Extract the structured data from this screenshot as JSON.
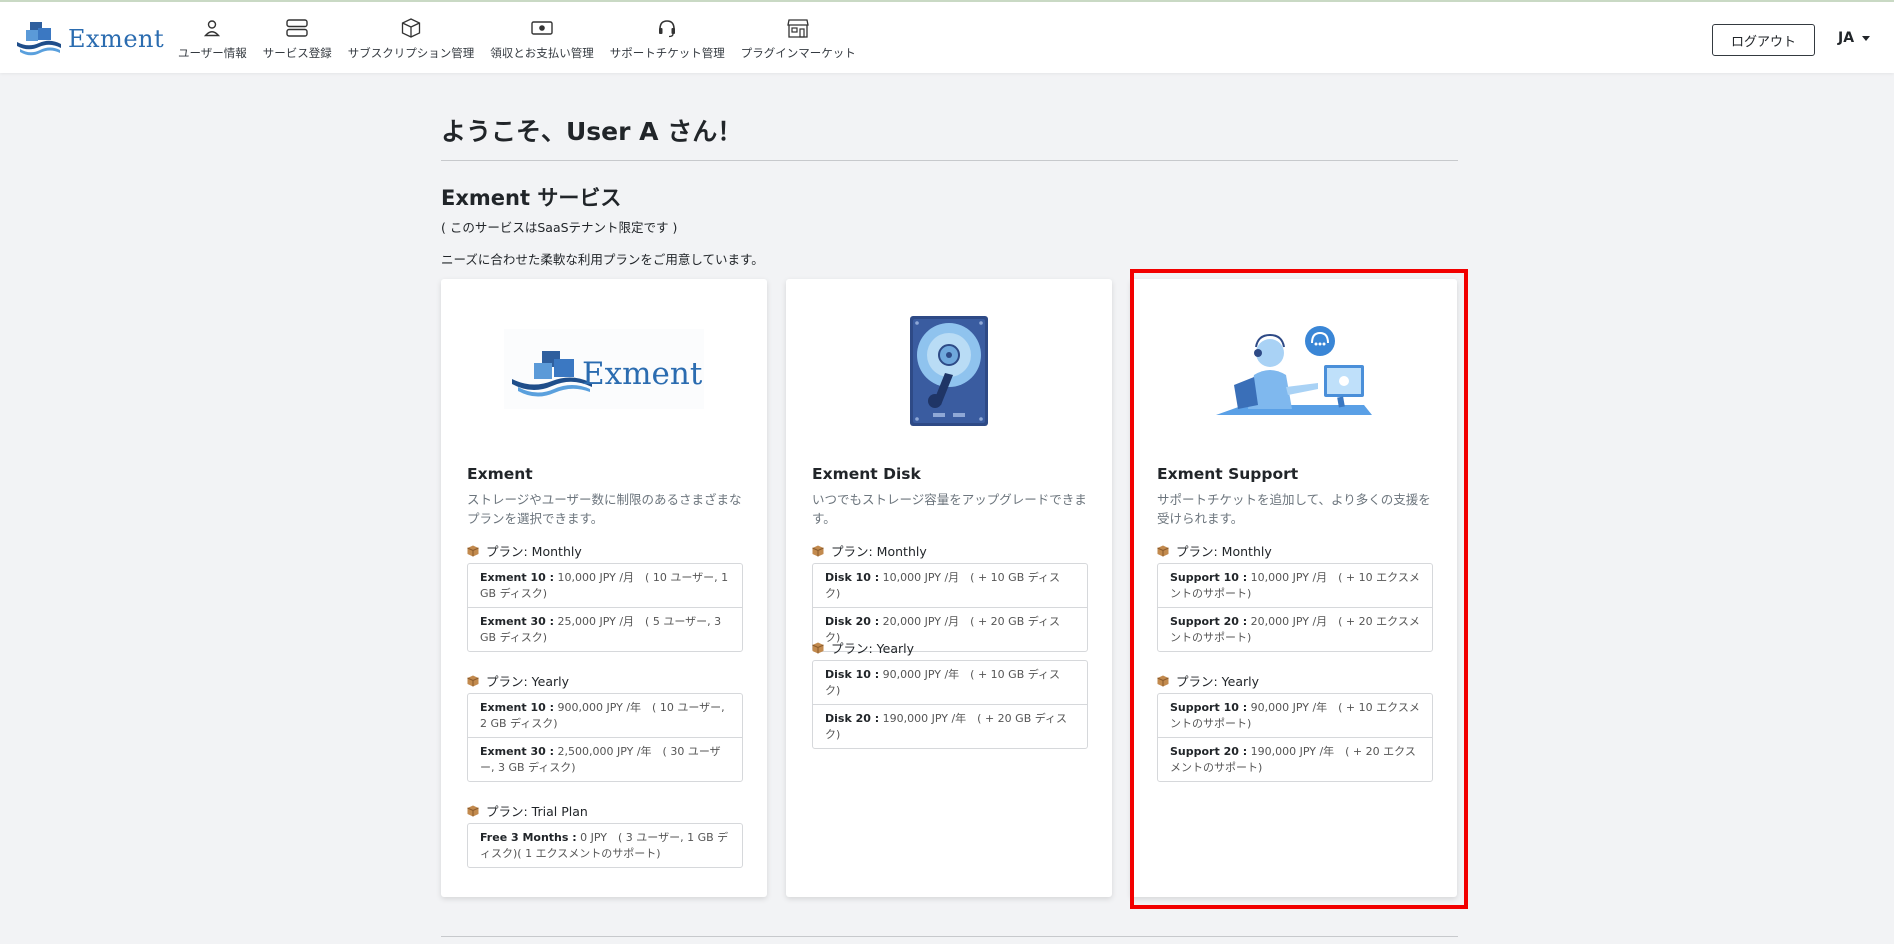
{
  "brand": {
    "name": "Exment"
  },
  "nav": [
    {
      "label": "ユーザー情報",
      "icon": "user-icon"
    },
    {
      "label": "サービス登録",
      "icon": "server-icon"
    },
    {
      "label": "サブスクリプション管理",
      "icon": "box-icon"
    },
    {
      "label": "領収とお支払い管理",
      "icon": "money-icon"
    },
    {
      "label": "サポートチケット管理",
      "icon": "headset-icon"
    },
    {
      "label": "プラグインマーケット",
      "icon": "shop-icon"
    }
  ],
  "header": {
    "logout": "ログアウト",
    "lang": "JA"
  },
  "main": {
    "welcome": "ようこそ、User A さん！",
    "section_title": "Exment サービス",
    "section_note": "( このサービスはSaaSテナント限定です )",
    "section_desc": "ニーズに合わせた柔軟な利用プランをご用意しています。"
  },
  "cards": [
    {
      "title": "Exment",
      "desc": "ストレージやユーザー数に制限のあるさまざまなプランを選択できます。",
      "image": "exment-logo",
      "groups": [
        {
          "head": "プラン: Monthly",
          "items": [
            {
              "name": "Exment 10 :",
              "text": " 10,000 JPY /月　( 10 ユーザー, 1 GB ディスク)"
            },
            {
              "name": "Exment 30 :",
              "text": " 25,000 JPY /月　( 5 ユーザー, 3 GB ディスク)"
            }
          ]
        },
        {
          "head": "プラン: Yearly",
          "items": [
            {
              "name": "Exment 10 :",
              "text": " 900,000 JPY /年　( 10 ユーザー, 2 GB ディスク)"
            },
            {
              "name": "Exment 30 :",
              "text": " 2,500,000 JPY /年　( 30 ユーザー, 3 GB ディスク)"
            }
          ]
        },
        {
          "head": "プラン: Trial Plan",
          "items": [
            {
              "name": "Free 3 Months :",
              "text": " 0 JPY　( 3 ユーザー, 1 GB ディスク)( 1 エクスメントのサポート)"
            }
          ]
        }
      ]
    },
    {
      "title": "Exment Disk",
      "desc": "いつでもストレージ容量をアップグレードできます。",
      "image": "hard-disk-image",
      "groups": [
        {
          "head": "プラン: Monthly",
          "items": [
            {
              "name": "Disk 10 :",
              "text": " 10,000 JPY /月　( + 10 GB ディスク)"
            },
            {
              "name": "Disk 20 :",
              "text": " 20,000 JPY /月　( + 20 GB ディスク)"
            }
          ]
        },
        {
          "head": "プラン: Yearly",
          "items": [
            {
              "name": "Disk 10 :",
              "text": " 90,000 JPY /年　( + 10 GB ディスク)"
            },
            {
              "name": "Disk 20 :",
              "text": " 190,000 JPY /年　( + 20 GB ディスク)"
            }
          ]
        }
      ]
    },
    {
      "title": "Exment Support",
      "desc": "サポートチケットを追加して、より多くの支援を受けられます。",
      "image": "support-operator-image",
      "groups": [
        {
          "head": "プラン: Monthly",
          "items": [
            {
              "name": "Support 10 :",
              "text": " 10,000 JPY /月　( + 10 エクスメントのサポート)"
            },
            {
              "name": "Support 20 :",
              "text": " 20,000 JPY /月　( + 20 エクスメントのサポート)"
            }
          ]
        },
        {
          "head": "プラン: Yearly",
          "items": [
            {
              "name": "Support 10 :",
              "text": " 90,000 JPY /年　( + 10 エクスメントのサポート)"
            },
            {
              "name": "Support 20 :",
              "text": " 190,000 JPY /年　( + 20 エクスメントのサポート)"
            }
          ]
        }
      ]
    }
  ],
  "colors": {
    "accent": "#2b6cb0",
    "highlight": "#f20000",
    "background": "#f2f3f5"
  }
}
